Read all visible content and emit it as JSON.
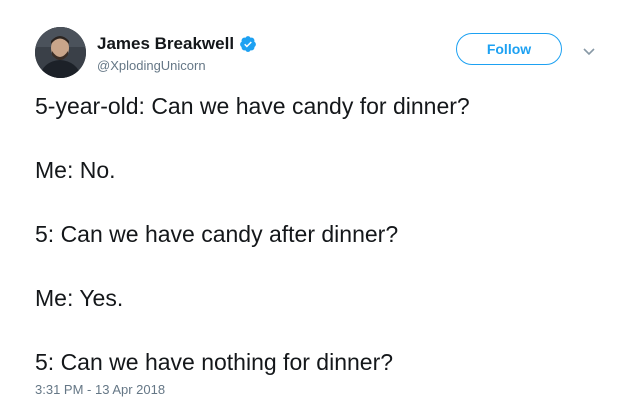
{
  "author": {
    "display_name": "James Breakwell",
    "handle": "@XplodingUnicorn",
    "verified": true,
    "avatar": "profile-photo"
  },
  "follow_label": "Follow",
  "tweet_lines": [
    "5-year-old: Can we have candy for dinner?",
    "Me: No.",
    "5: Can we have candy after dinner?",
    "Me: Yes.",
    "5: Can we have nothing for dinner?"
  ],
  "timestamp": "3:31 PM - 13 Apr 2018",
  "colors": {
    "accent": "#1da1f2",
    "text": "#14171a",
    "muted": "#657786"
  },
  "icons": [
    "verified-badge-icon",
    "chevron-down-icon"
  ]
}
